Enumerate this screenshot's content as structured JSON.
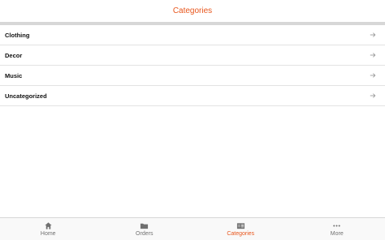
{
  "header": {
    "title": "Categories"
  },
  "categories": [
    {
      "label": "Clothing"
    },
    {
      "label": "Decor"
    },
    {
      "label": "Music"
    },
    {
      "label": "Uncategorized"
    }
  ],
  "tabs": [
    {
      "label": "Home",
      "icon": "home-icon",
      "active": false
    },
    {
      "label": "Orders",
      "icon": "folder-icon",
      "active": false
    },
    {
      "label": "Categories",
      "icon": "categories-book-icon",
      "active": true
    },
    {
      "label": "More",
      "icon": "more-dots-icon",
      "active": false
    }
  ],
  "colors": {
    "accent": "#e8571e",
    "inactive": "#707070",
    "divider": "#d7d7d7"
  }
}
